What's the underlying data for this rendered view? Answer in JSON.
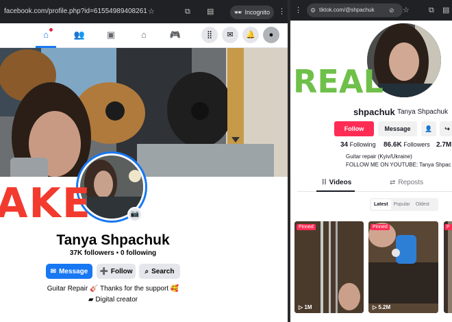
{
  "left_window": {
    "url": "facebook.com/profile.php?id=61554989408261",
    "incognito_label": "Incognito",
    "overlay_label": "AKE",
    "profile": {
      "name": "Tanya Shpachuk",
      "followers": "37K followers",
      "following": "0 following",
      "separator": "•",
      "buttons": {
        "message": "Message",
        "follow": "Follow",
        "search": "Search"
      },
      "bio": "Guitar Repair 🎸 Thanks for the support 🥰",
      "category": "Digital creator"
    },
    "colors": {
      "accent": "#1877f2",
      "overlay": "#f23b2e"
    }
  },
  "right_window": {
    "url": "tiktok.com/@shpachuk",
    "overlay_label": "REAL",
    "profile": {
      "username": "shpachuk",
      "nickname": "Tanya Shpachuk",
      "buttons": {
        "follow": "Follow",
        "message": "Message"
      },
      "stats": [
        {
          "value": "34",
          "label": "Following"
        },
        {
          "value": "86.6K",
          "label": "Followers"
        },
        {
          "value": "2.7M",
          "label": ""
        }
      ],
      "bio_lines": [
        "Guitar repair (Kyiv/Ukraine)",
        "FOLLOW ME ON YOUTUBE: Tanya Shpac"
      ]
    },
    "tabs": {
      "videos": "Videos",
      "reposts": "Reposts"
    },
    "sort_options": [
      "Latest",
      "Popular",
      "Oldest"
    ],
    "videos": [
      {
        "pinned": "Pinned",
        "views": "1M"
      },
      {
        "pinned": "Pinned",
        "views": "5.2M"
      },
      {
        "pinned": "",
        "views": ""
      }
    ],
    "colors": {
      "accent": "#fe2c55",
      "overlay": "#6fc04a"
    }
  }
}
